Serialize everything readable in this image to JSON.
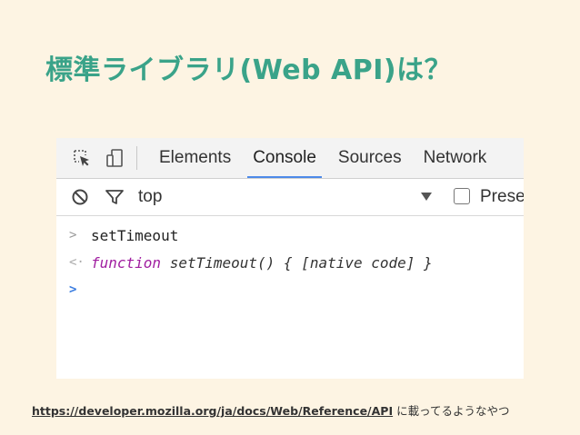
{
  "slide": {
    "title": "標準ライブラリ(Web API)は？"
  },
  "devtools": {
    "tabs": [
      "Elements",
      "Console",
      "Sources",
      "Network"
    ],
    "active_tab": "Console",
    "filter": {
      "context": "top",
      "preserve_label": "Prese"
    },
    "console": {
      "input_prompt": ">",
      "output_prompt": "<·",
      "active_prompt": ">",
      "input": "setTimeout",
      "output_keyword": "function",
      "output_rest": " setTimeout() { [native code] }"
    }
  },
  "footer": {
    "link": "https://developer.mozilla.org/ja/docs/Web/Reference/API",
    "suffix": " に載ってるようなやつ"
  },
  "colors": {
    "background": "#fdf4e3",
    "title": "#3aa389",
    "active_tab_underline": "#4d8ae8",
    "keyword": "#a01ea0"
  }
}
